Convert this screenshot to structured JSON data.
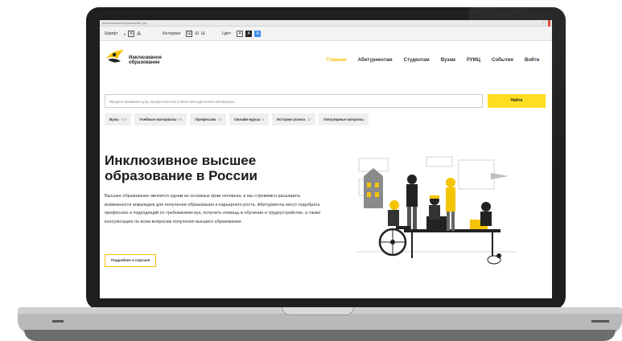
{
  "browser": {
    "url": "инклюзивноеобразование.рф"
  },
  "a11y": {
    "font_label": "Шрифт",
    "font_small": "A",
    "font_medium": "A",
    "font_large": "A",
    "spacing_label": "Интервал",
    "spacing_1": "Ш",
    "spacing_2": "Ш",
    "spacing_3": "Ш",
    "color_label": "Цвет",
    "color_1": "A",
    "color_2": "A",
    "color_3": "A"
  },
  "logo": {
    "line1": "Инклюзивное",
    "line2": "образование"
  },
  "nav": {
    "items": [
      "Главная",
      "Абитуриентам",
      "Студентам",
      "Вузам",
      "РУМЦ",
      "События"
    ],
    "login": "Войти",
    "login_arrow": "→"
  },
  "search": {
    "placeholder": "Введите название вуза, профессии или учебно-методического материала..",
    "button": "Найти"
  },
  "chips": [
    {
      "label": "Вузы",
      "count": "715"
    },
    {
      "label": "Учебные материалы",
      "count": "85"
    },
    {
      "label": "Профессии",
      "count": "74"
    },
    {
      "label": "Онлайн-курсы",
      "count": "6"
    },
    {
      "label": "Истории успеха",
      "count": "33"
    },
    {
      "label": "Популярные вопросы",
      "count": ""
    }
  ],
  "hero": {
    "title": "Инклюзивное высшее образование в России",
    "text": "Высшее образование является одним из основных прав человека, и мы стремимся расширить возможности инвалидов для получения образования и карьерного роста. Абитуриенты могут подобрать профессию и подходящий по требованиям вуз, получить помощь в обучении и трудоустройстве, а также консультацию по всем вопросам получения высшего образования.",
    "button": "Подробнее о портале"
  },
  "colors": {
    "accent": "#ffde21",
    "accent_text": "#f5b800",
    "frame": "#1f1f1f"
  },
  "icons": [
    "logo-mark-icon",
    "star-icon",
    "login-arrow-icon",
    "illustration"
  ]
}
